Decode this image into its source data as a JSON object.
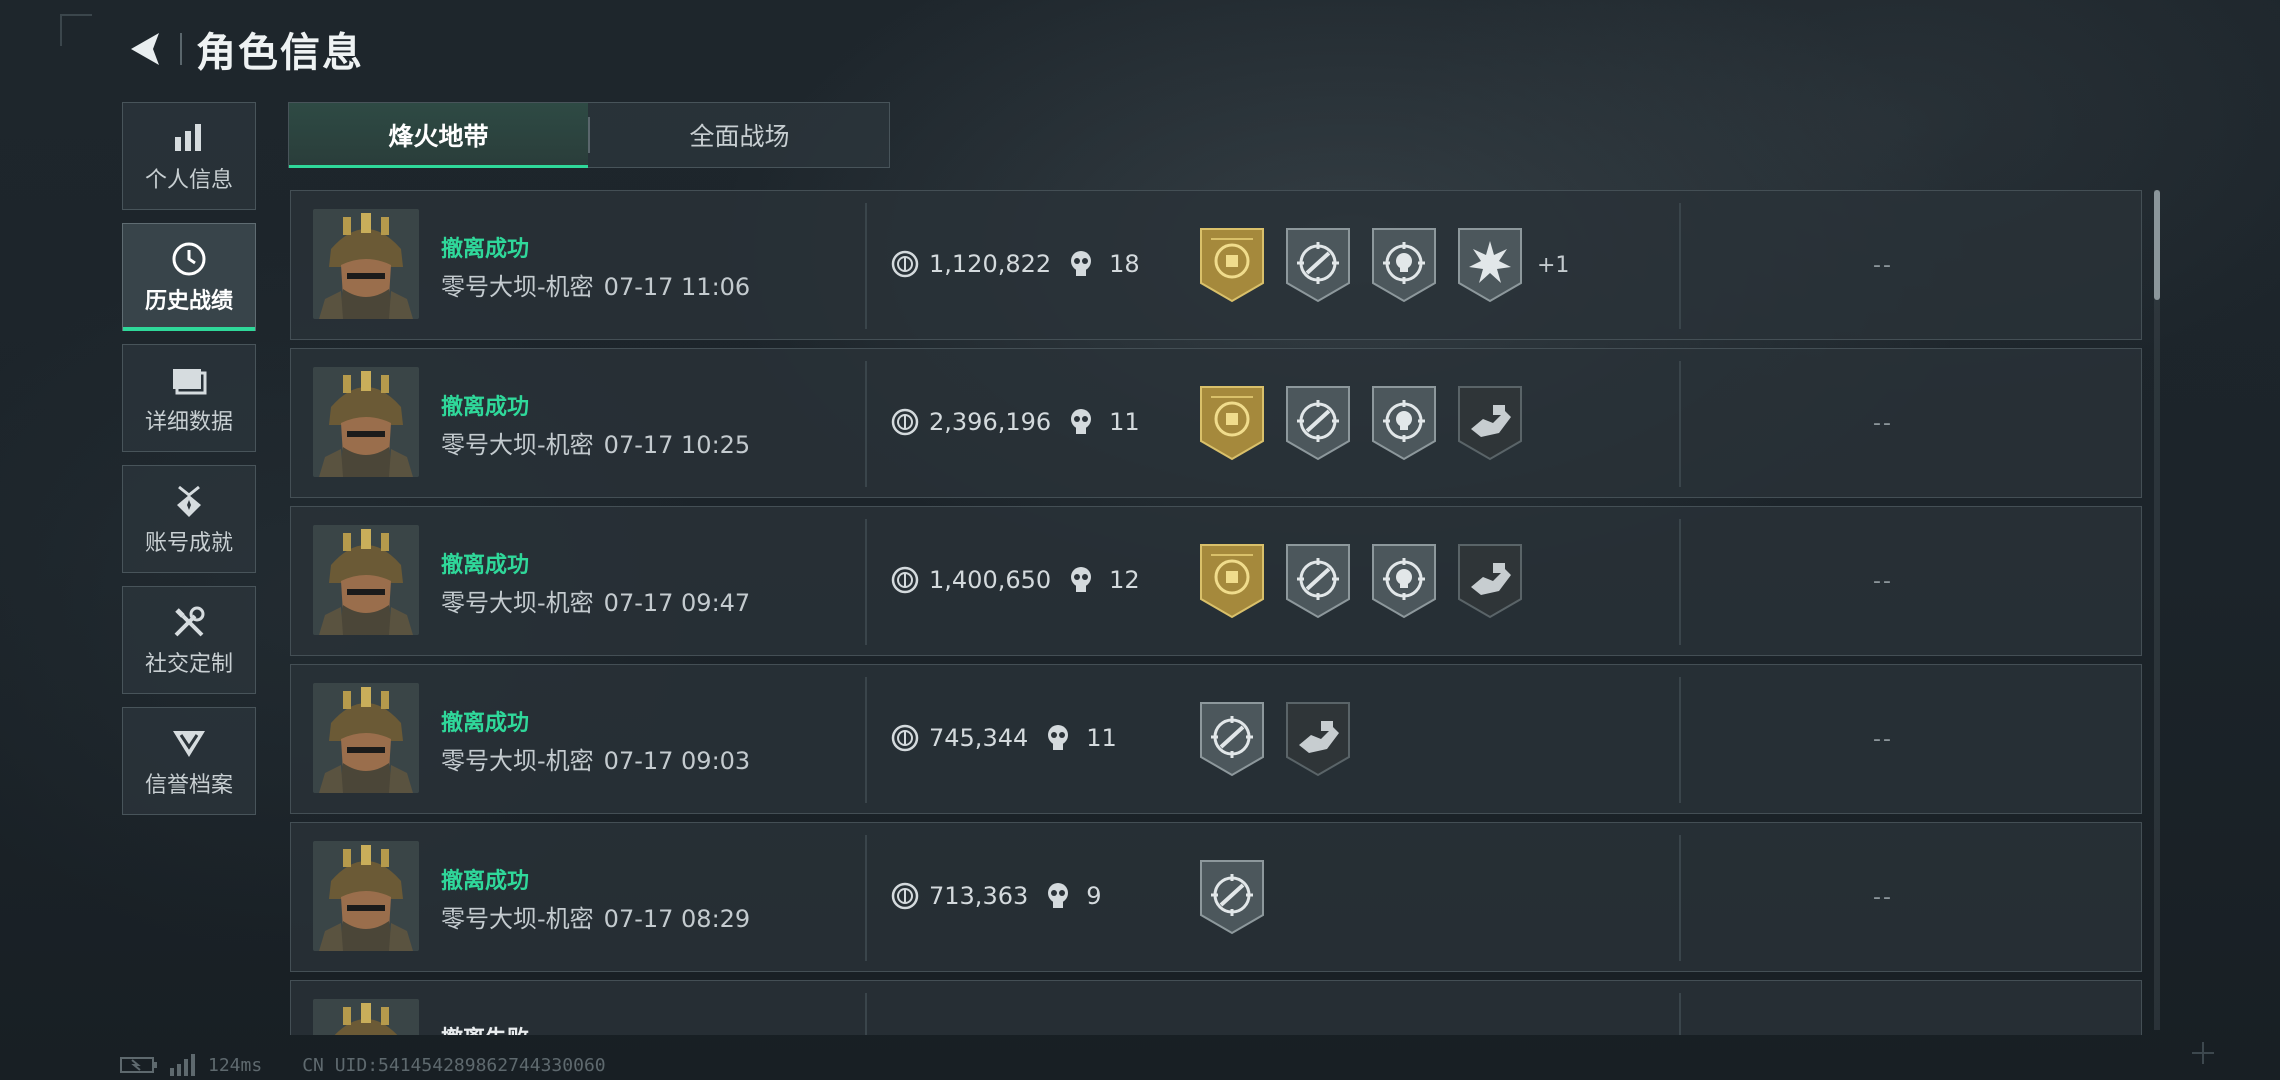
{
  "header": {
    "title": "角色信息"
  },
  "sidebar": {
    "items": [
      {
        "label": "个人信息",
        "icon": "bar-chart-icon"
      },
      {
        "label": "历史战绩",
        "icon": "clock-icon",
        "active": true
      },
      {
        "label": "详细数据",
        "icon": "folder-icon"
      },
      {
        "label": "账号成就",
        "icon": "achievement-icon"
      },
      {
        "label": "社交定制",
        "icon": "tools-icon"
      },
      {
        "label": "信誉档案",
        "icon": "shield-v-icon"
      }
    ]
  },
  "tabs": [
    {
      "label": "烽火地带",
      "active": true
    },
    {
      "label": "全面战场",
      "active": false
    }
  ],
  "records": [
    {
      "status": "撤离成功",
      "map": "零号大坝-机密",
      "time": "07-17 11:06",
      "value": "1,120,822",
      "kills": "18",
      "badges": [
        "gold-badge-icon",
        "gun-target-badge-icon",
        "skull-target-badge-icon",
        "explosion-badge-icon"
      ],
      "extra": "+1",
      "result": "--"
    },
    {
      "status": "撤离成功",
      "map": "零号大坝-机密",
      "time": "07-17 10:25",
      "value": "2,396,196",
      "kills": "11",
      "badges": [
        "gold-badge-icon",
        "gun-target-badge-icon",
        "skull-target-badge-icon",
        "hand-item-badge-icon"
      ],
      "extra": "",
      "result": "--"
    },
    {
      "status": "撤离成功",
      "map": "零号大坝-机密",
      "time": "07-17 09:47",
      "value": "1,400,650",
      "kills": "12",
      "badges": [
        "gold-badge-icon",
        "gun-target-badge-icon",
        "skull-target-badge-icon",
        "hand-item-badge-icon"
      ],
      "extra": "",
      "result": "--"
    },
    {
      "status": "撤离成功",
      "map": "零号大坝-机密",
      "time": "07-17 09:03",
      "value": "745,344",
      "kills": "11",
      "badges": [
        "gun-target-badge-icon",
        "hand-item-badge-icon"
      ],
      "extra": "",
      "result": "--"
    },
    {
      "status": "撤离成功",
      "map": "零号大坝-机密",
      "time": "07-17 08:29",
      "value": "713,363",
      "kills": "9",
      "badges": [
        "gun-target-badge-icon"
      ],
      "extra": "",
      "result": "--"
    },
    {
      "status": "撤离失败",
      "map": "",
      "time": "",
      "value": "",
      "kills": "",
      "badges": [],
      "extra": "",
      "result": ""
    }
  ],
  "footer": {
    "ping": "124ms",
    "uid": "CN UID:541454289862744330060"
  },
  "colors": {
    "accent": "#2fd89a",
    "gold": "#c9a94a"
  }
}
